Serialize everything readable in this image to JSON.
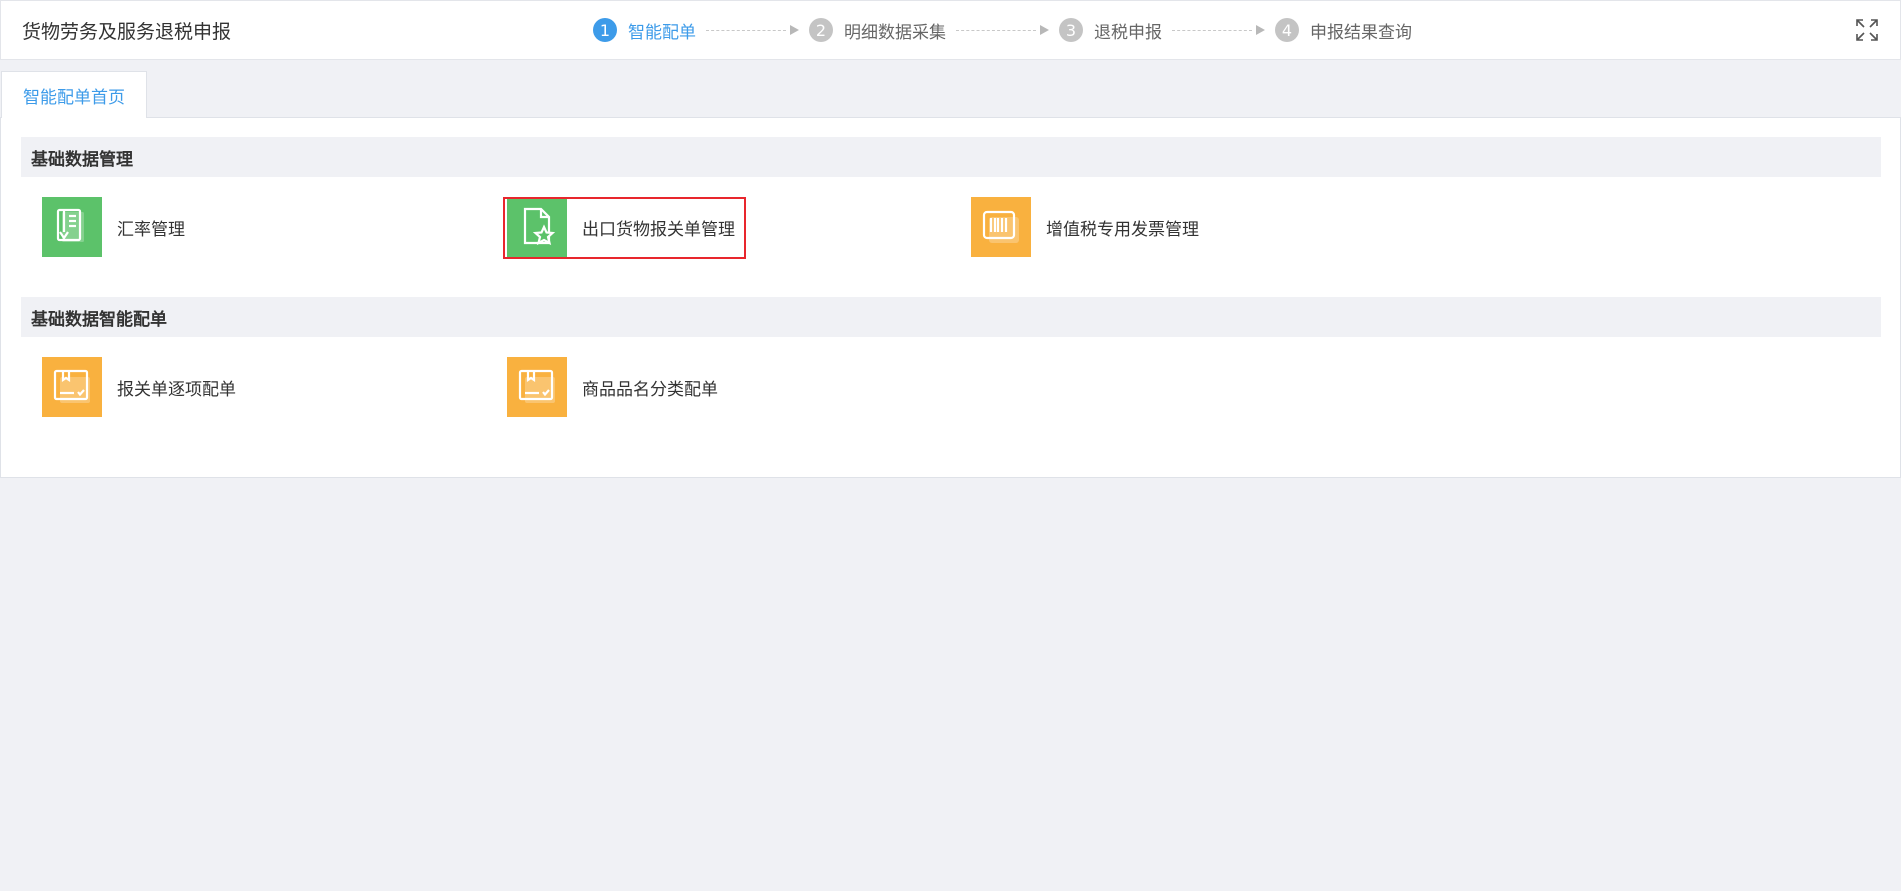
{
  "header": {
    "title": "货物劳务及服务退税申报",
    "steps": [
      {
        "number": "1",
        "label": "智能配单",
        "active": true
      },
      {
        "number": "2",
        "label": "明细数据采集",
        "active": false
      },
      {
        "number": "3",
        "label": "退税申报",
        "active": false
      },
      {
        "number": "4",
        "label": "申报结果查询",
        "active": false
      }
    ],
    "fullscreen_icon": "fullscreen-icon"
  },
  "tabs": [
    {
      "label": "智能配单首页",
      "active": true
    }
  ],
  "sections": [
    {
      "title": "基础数据管理",
      "items": [
        {
          "label": "汇率管理",
          "icon": "exchange-rate-icon",
          "color": "#5cc26a"
        },
        {
          "label": "出口货物报关单管理",
          "icon": "customs-declaration-icon",
          "color": "#5cc26a",
          "highlighted": true
        },
        {
          "label": "增值税专用发票管理",
          "icon": "vat-invoice-icon",
          "color": "#f9b13f"
        }
      ]
    },
    {
      "title": "基础数据智能配单",
      "items": [
        {
          "label": "报关单逐项配单",
          "icon": "item-matching-icon",
          "color": "#f9b13f"
        },
        {
          "label": "商品品名分类配单",
          "icon": "category-matching-icon",
          "color": "#f9b13f"
        }
      ]
    }
  ],
  "colors": {
    "accent": "#3d9be9",
    "inactive_step": "#c4c4c4",
    "green_tile": "#5cc26a",
    "orange_tile": "#f9b13f",
    "highlight": "#e8262d"
  }
}
